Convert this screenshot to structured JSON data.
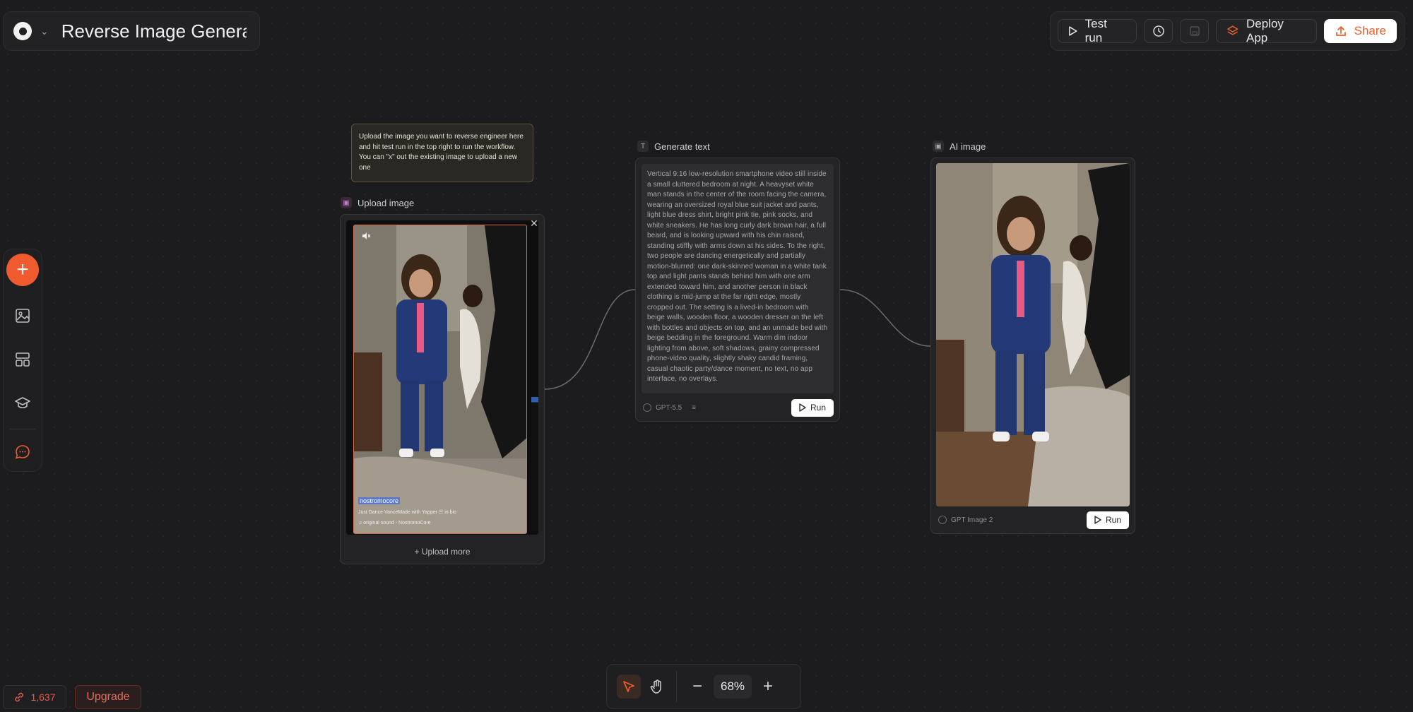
{
  "project": {
    "title": "Reverse Image Generat"
  },
  "toolbar": {
    "test_run_label": "Test run",
    "deploy_label": "Deploy App",
    "share_label": "Share"
  },
  "note": {
    "text": "Upload the image you want to reverse engineer here and hit test run in the top right to run the workflow. You can \"x\" out the existing image to upload a new one"
  },
  "upload_node": {
    "label": "Upload image",
    "upload_more_label": "Upload more",
    "overlay": {
      "username": "nostromocore",
      "caption": "Just Dance VanceMade with Yapper ☵ in bio",
      "sound": "original sound - NostromoCore"
    }
  },
  "generate_node": {
    "label": "Generate text",
    "text": "Vertical 9:16 low-resolution smartphone video still inside a small cluttered bedroom at night. A heavyset white man stands in the center of the room facing the camera, wearing an oversized royal blue suit jacket and pants, light blue dress shirt, bright pink tie, pink socks, and white sneakers. He has long curly dark brown hair, a full beard, and is looking upward with his chin raised, standing stiffly with arms down at his sides. To the right, two people are dancing energetically and partially motion-blurred: one dark-skinned woman in a white tank top and light pants stands behind him with one arm extended toward him, and another person in black clothing is mid-jump at the far right edge, mostly cropped out. The setting is a lived-in bedroom with beige walls, wooden floor, a wooden dresser on the left with bottles and objects on top, and an unmade bed with beige bedding in the foreground. Warm dim indoor lighting from above, soft shadows, grainy compressed phone-video quality, slightly shaky candid framing, casual chaotic party/dance moment, no text, no app interface, no overlays.",
    "model": "GPT-5.5",
    "run_label": "Run"
  },
  "ai_node": {
    "label": "AI image",
    "model": "GPT Image 2",
    "run_label": "Run"
  },
  "credits": {
    "value": "1,637"
  },
  "upgrade": {
    "label": "Upgrade"
  },
  "zoom": {
    "value": "68%"
  },
  "colors": {
    "accent": "#ef5a2f",
    "canvas": "#1c1c1e"
  }
}
